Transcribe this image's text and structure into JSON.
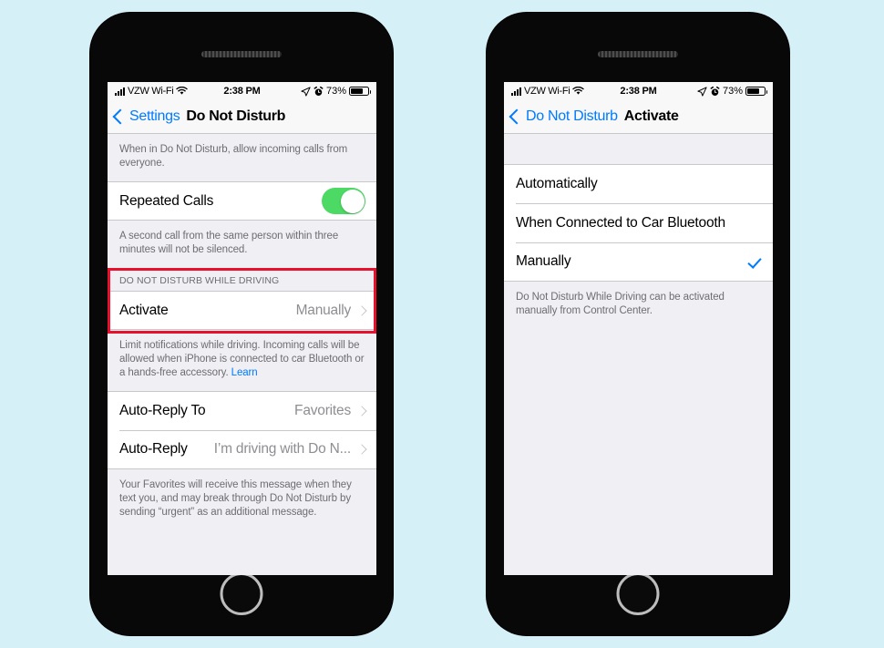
{
  "background_color": "#d6f0f8",
  "accent_color": "#007aff",
  "highlight_color": "#e8112d",
  "toggle_on_color": "#4cd964",
  "status_bar": {
    "carrier": "VZW Wi-Fi",
    "time": "2:38 PM",
    "battery_percent": "73%",
    "signal_icon": "signal-bars-icon",
    "wifi_icon": "wifi-icon",
    "location_icon": "location-arrow-icon",
    "alarm_icon": "alarm-clock-icon",
    "battery_icon": "battery-icon"
  },
  "phone_left": {
    "nav": {
      "back_label": "Settings",
      "title": "Do Not Disturb",
      "back_icon": "chevron-left-icon"
    },
    "top_footnote": "When in Do Not Disturb, allow incoming calls from everyone.",
    "repeated_calls": {
      "label": "Repeated Calls",
      "toggle_state": "on"
    },
    "repeated_calls_footnote": "A second call from the same person within three minutes will not be silenced.",
    "driving_section": {
      "header": "DO NOT DISTURB WHILE DRIVING",
      "activate_label": "Activate",
      "activate_value": "Manually",
      "chevron_icon": "chevron-right-icon"
    },
    "driving_footnote": {
      "text": "Limit notifications while driving. Incoming calls will be allowed when iPhone is connected to car Bluetooth or a hands-free accessory. ",
      "link": "Learn"
    },
    "auto_reply_to": {
      "label": "Auto-Reply To",
      "value": "Favorites"
    },
    "auto_reply": {
      "label": "Auto-Reply",
      "value": "I’m driving with Do N..."
    },
    "bottom_footnote": "Your Favorites will receive this message when they text you, and may break through Do Not Disturb by sending “urgent” as an additional message."
  },
  "phone_right": {
    "nav": {
      "back_label": "Do Not Disturb",
      "title": "Activate",
      "back_icon": "chevron-left-icon"
    },
    "options": [
      {
        "label": "Automatically",
        "selected": false
      },
      {
        "label": "When Connected to Car Bluetooth",
        "selected": false
      },
      {
        "label": "Manually",
        "selected": true
      }
    ],
    "footnote": "Do Not Disturb While Driving can be activated manually from Control Center."
  }
}
